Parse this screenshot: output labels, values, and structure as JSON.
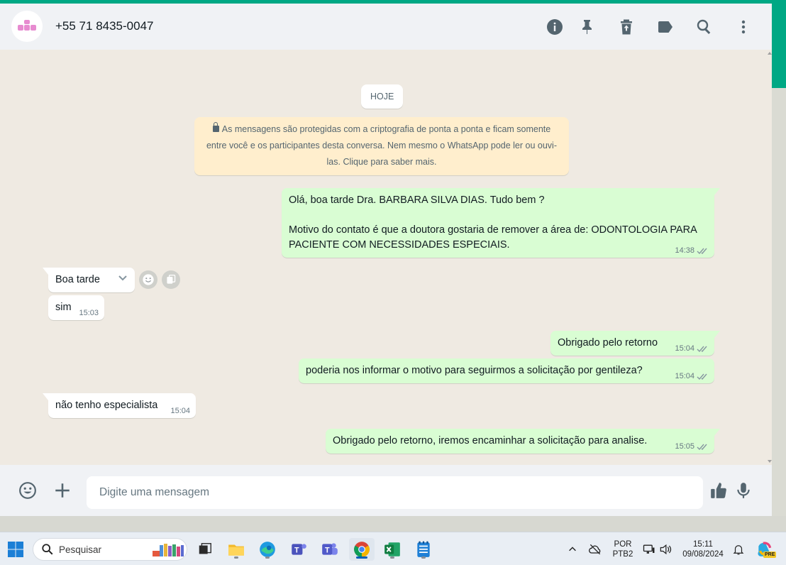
{
  "header": {
    "contact_name": "+55 71 8435-0047",
    "icons": [
      "info-icon",
      "pin-icon",
      "archive-icon",
      "label-icon",
      "search-icon",
      "menu-icon"
    ]
  },
  "chat": {
    "date_chip": "HOJE",
    "encryption_notice": "As mensagens são protegidas com a criptografia de ponta a ponta e ficam somente entre você e os participantes desta conversa. Nem mesmo o WhatsApp pode ler ou ouvi-las. Clique para saber mais.",
    "messages": [
      {
        "direction": "out",
        "text": "Olá, boa tarde Dra. BARBARA SILVA DIAS. Tudo bem ?\n\nMotivo do contato é que a doutora gostaria de remover a área de: ODONTOLOGIA PARA PACIENTE COM NECESSIDADES ESPECIAIS.",
        "time": "14:38",
        "status": "read"
      },
      {
        "direction": "in",
        "text": "Boa tarde",
        "time": "15:03"
      },
      {
        "direction": "in",
        "text": "sim",
        "time": "15:03"
      },
      {
        "direction": "out",
        "text": "Obrigado pelo retorno",
        "time": "15:04",
        "status": "read"
      },
      {
        "direction": "out",
        "text": "poderia nos informar o motivo para seguirmos a solicitação por gentileza?",
        "time": "15:04",
        "status": "read"
      },
      {
        "direction": "in",
        "text": "não tenho especialista",
        "time": "15:04"
      },
      {
        "direction": "out",
        "text": "Obrigado pelo retorno, iremos encaminhar a solicitação para analise.",
        "time": "15:05",
        "status": "read"
      }
    ]
  },
  "composer": {
    "placeholder": "Digite uma mensagem"
  },
  "taskbar": {
    "search_label": "Pesquisar",
    "language_line1": "POR",
    "language_line2": "PTB2",
    "time": "15:11",
    "date": "09/08/2024",
    "copilot_badge": "PRE"
  },
  "colors": {
    "accent": "#00a884",
    "outgoing_bubble": "#d9fdd3",
    "incoming_bubble": "#ffffff",
    "chat_bg": "#efeae2",
    "notice_bg": "#ffeecd"
  }
}
